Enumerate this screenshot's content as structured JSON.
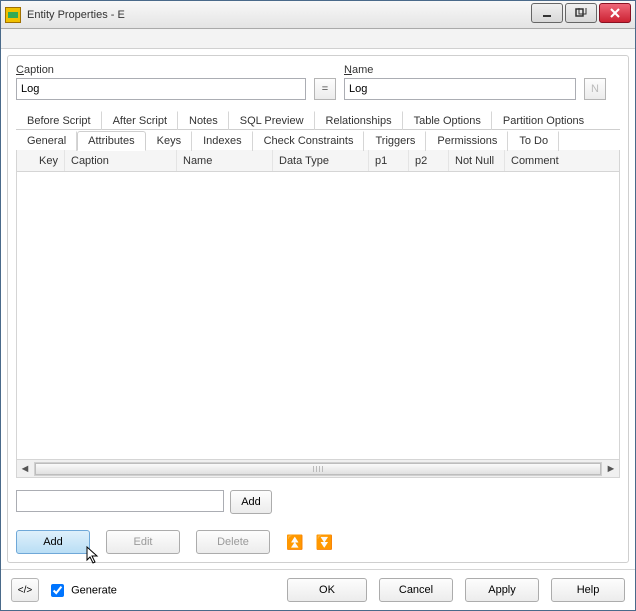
{
  "window": {
    "title": "Entity Properties - E"
  },
  "fields": {
    "caption_label": "Caption",
    "caption_value": "Log",
    "name_label": "Name",
    "name_value": "Log",
    "equals_btn": "=",
    "n_btn": "N"
  },
  "tabs_row1": {
    "before_script": "Before Script",
    "after_script": "After Script",
    "notes": "Notes",
    "sql_preview": "SQL Preview",
    "relationships": "Relationships",
    "table_options": "Table Options",
    "partition_options": "Partition Options"
  },
  "tabs_row2": {
    "general": "General",
    "attributes": "Attributes",
    "keys": "Keys",
    "indexes": "Indexes",
    "check_constraints": "Check Constraints",
    "triggers": "Triggers",
    "permissions": "Permissions",
    "todo": "To Do"
  },
  "columns": {
    "key": "Key",
    "caption": "Caption",
    "name": "Name",
    "datatype": "Data Type",
    "p1": "p1",
    "p2": "p2",
    "notnull": "Not Null",
    "comment": "Comment"
  },
  "inline_add": {
    "add_label": "Add"
  },
  "actions": {
    "add": "Add",
    "edit": "Edit",
    "delete": "Delete"
  },
  "footer": {
    "generate_label": "Generate",
    "ok": "OK",
    "cancel": "Cancel",
    "apply": "Apply",
    "help": "Help"
  }
}
